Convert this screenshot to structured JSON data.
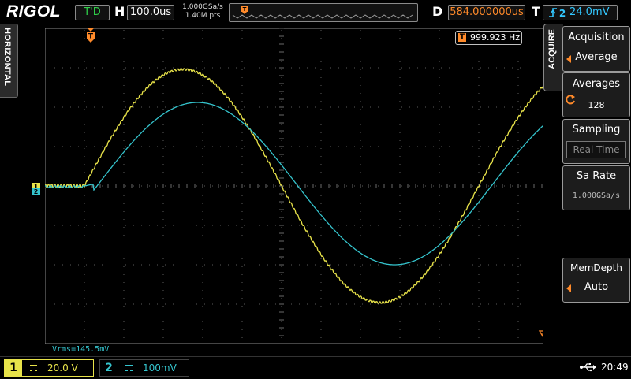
{
  "top": {
    "brand": "RIGOL",
    "run_state": "T'D",
    "h_label": "H",
    "timebase": "100.0us",
    "sample_rate": "1.000GSa/s",
    "mem_points": "1.40M pts",
    "d_label": "D",
    "delay": "584.000000us",
    "t_label": "T",
    "trigger_level": "24.0mV"
  },
  "left": {
    "tab_label": "HORIZONTAL"
  },
  "screen": {
    "frequency": "999.923 Hz",
    "measurement": "Vrms=145.5mV",
    "ch1_marker": "1",
    "ch2_marker": "2",
    "trigger_marker": "T"
  },
  "menu": {
    "tab_label": "ACQUIRE",
    "items": [
      {
        "title": "Acquisition",
        "value": "Average"
      },
      {
        "title": "Averages",
        "value": "128"
      },
      {
        "title": "Sampling",
        "value": "Real Time"
      },
      {
        "title": "Sa Rate",
        "value": "1.000GSa/s"
      },
      {
        "title": "MemDepth",
        "value": "Auto"
      }
    ]
  },
  "bottom": {
    "ch1_num": "1",
    "ch1_scale": "20.0 V",
    "ch2_num": "2",
    "ch2_scale": "100mV",
    "clock": "20:49"
  },
  "colors": {
    "ch1": "#e8e34a",
    "ch2": "#35c5ce",
    "trigger": "#ff8a2a",
    "accent_blue": "#33c8ff"
  },
  "icons": [
    "rising-edge-trigger-icon",
    "usb-icon",
    "orange-knob-arrow-icon",
    "knob-rotate-icon"
  ]
}
